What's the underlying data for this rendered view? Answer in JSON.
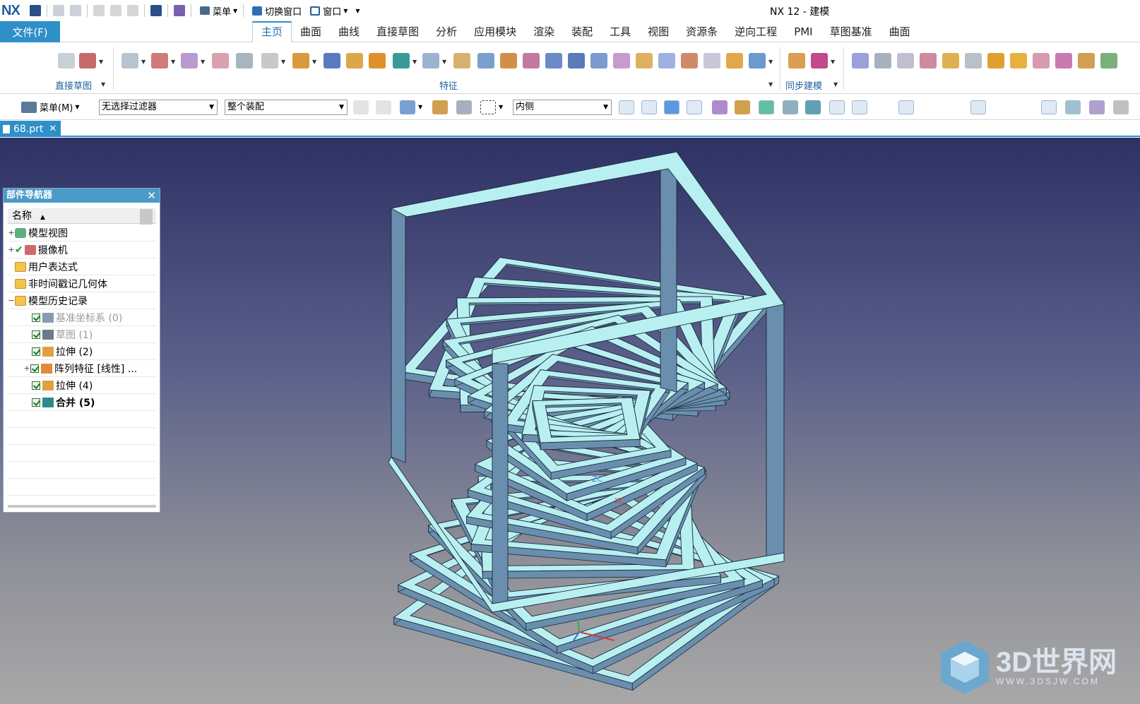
{
  "app": {
    "logo": "NX",
    "title": "NX 12 - 建模"
  },
  "quick_access": {
    "menu_label": "菜单",
    "switch_window": "切换窗口",
    "window": "窗口"
  },
  "ribbon": {
    "file_label": "文件(F)",
    "tabs": [
      "主页",
      "曲面",
      "曲线",
      "直接草图",
      "分析",
      "应用模块",
      "渲染",
      "装配",
      "工具",
      "视图",
      "资源条",
      "逆向工程",
      "PMI",
      "草图基准",
      "曲面"
    ],
    "active_tab": "主页",
    "groups": {
      "direct_sketch": "直接草图",
      "feature": "特征",
      "sync_modeling": "同步建模"
    }
  },
  "selection_bar": {
    "menu_label": "菜单(M)",
    "filter": "无选择过滤器",
    "scope": "整个装配",
    "side": "内侧"
  },
  "document": {
    "tab_label": "68.prt"
  },
  "navigator": {
    "title": "部件导航器",
    "column_name": "名称",
    "items": [
      {
        "label": "模型视图",
        "icon": "model-views-icon"
      },
      {
        "label": "摄像机",
        "icon": "camera-icon"
      },
      {
        "label": "用户表达式",
        "icon": "folder-icon"
      },
      {
        "label": "非时间戳记几何体",
        "icon": "folder-icon"
      },
      {
        "label": "模型历史记录",
        "icon": "folder-icon"
      },
      {
        "label": "基准坐标系 (0)",
        "icon": "datum-csys-icon"
      },
      {
        "label": "草图 (1)",
        "icon": "sketch-icon"
      },
      {
        "label": "拉伸 (2)",
        "icon": "extrude-icon"
      },
      {
        "label": "阵列特征 [线性] ...",
        "icon": "pattern-feature-icon"
      },
      {
        "label": "拉伸 (4)",
        "icon": "extrude-icon"
      },
      {
        "label": "合并 (5)",
        "icon": "unite-icon"
      }
    ]
  },
  "viewport": {
    "axis_z": "ZC",
    "axis_x": "XC"
  },
  "watermark": {
    "name": "3D世界网",
    "url": "WWW.3DSJW.COM"
  },
  "colors": {
    "accent": "#2f8fc8",
    "face_light": "#b8f0f2",
    "face_dark": "#6a8fae",
    "edge": "#1c2a3a"
  }
}
